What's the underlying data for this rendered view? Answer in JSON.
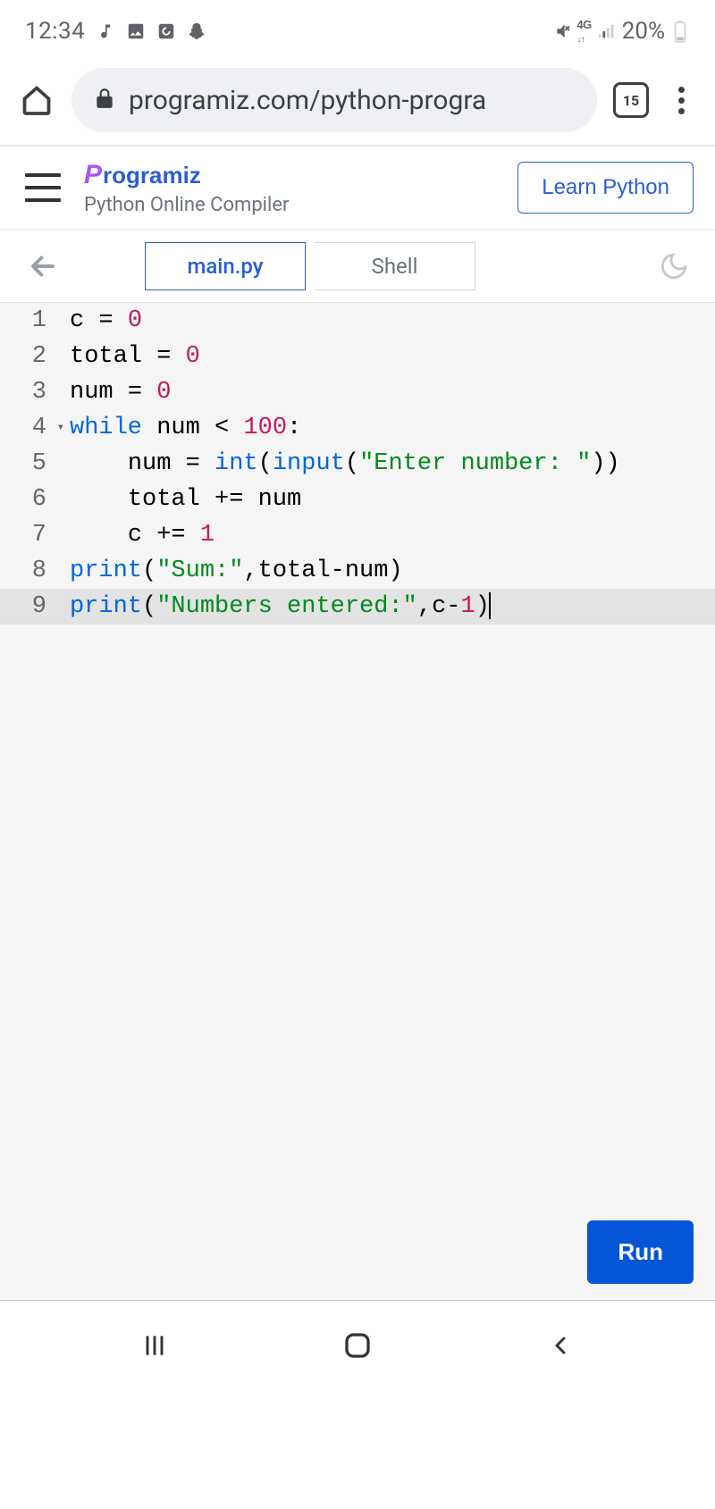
{
  "status": {
    "time": "12:34",
    "battery_pct": "20%",
    "icons": [
      "music-note",
      "image",
      "refresh-box",
      "snapchat"
    ],
    "net_label": "4G"
  },
  "browser": {
    "url": "programiz.com/python-progra",
    "tab_count": "15"
  },
  "site": {
    "brand": "rogramiz",
    "brand_prefix": "P",
    "subtitle": "Python Online Compiler",
    "learn_btn": "Learn Python"
  },
  "tabs": {
    "main": "main.py",
    "shell": "Shell"
  },
  "editor": {
    "lines": [
      {
        "n": 1,
        "indent": "",
        "tokens": [
          [
            "txt",
            "c "
          ],
          [
            "op",
            "="
          ],
          [
            "txt",
            " "
          ],
          [
            "num",
            "0"
          ]
        ]
      },
      {
        "n": 2,
        "indent": "",
        "tokens": [
          [
            "txt",
            "total "
          ],
          [
            "op",
            "="
          ],
          [
            "txt",
            " "
          ],
          [
            "num",
            "0"
          ]
        ]
      },
      {
        "n": 3,
        "indent": "",
        "tokens": [
          [
            "txt",
            "num "
          ],
          [
            "op",
            "="
          ],
          [
            "txt",
            " "
          ],
          [
            "num",
            "0"
          ]
        ]
      },
      {
        "n": 4,
        "indent": "",
        "fold": true,
        "tokens": [
          [
            "kw",
            "while"
          ],
          [
            "txt",
            " num "
          ],
          [
            "op",
            "<"
          ],
          [
            "txt",
            " "
          ],
          [
            "num",
            "100"
          ],
          [
            "txt",
            ":"
          ]
        ]
      },
      {
        "n": 5,
        "indent": "    ",
        "tokens": [
          [
            "txt",
            "num "
          ],
          [
            "op",
            "="
          ],
          [
            "txt",
            " "
          ],
          [
            "builtin",
            "int"
          ],
          [
            "txt",
            "("
          ],
          [
            "builtin",
            "input"
          ],
          [
            "txt",
            "("
          ],
          [
            "str",
            "\"Enter number: \""
          ],
          [
            "txt",
            "))"
          ]
        ]
      },
      {
        "n": 6,
        "indent": "    ",
        "tokens": [
          [
            "txt",
            "total "
          ],
          [
            "op",
            "+="
          ],
          [
            "txt",
            " num"
          ]
        ]
      },
      {
        "n": 7,
        "indent": "    ",
        "tokens": [
          [
            "txt",
            "c "
          ],
          [
            "op",
            "+="
          ],
          [
            "txt",
            " "
          ],
          [
            "num",
            "1"
          ]
        ]
      },
      {
        "n": 8,
        "indent": "",
        "tokens": [
          [
            "builtin",
            "print"
          ],
          [
            "txt",
            "("
          ],
          [
            "str",
            "\"Sum:\""
          ],
          [
            "txt",
            ",total"
          ],
          [
            "op",
            "-"
          ],
          [
            "txt",
            "num)"
          ]
        ]
      },
      {
        "n": 9,
        "indent": "",
        "active": true,
        "tokens": [
          [
            "builtin",
            "print"
          ],
          [
            "txt",
            "("
          ],
          [
            "str",
            "\"Numbers entered:\""
          ],
          [
            "txt",
            ",c"
          ],
          [
            "op",
            "-"
          ],
          [
            "num",
            "1"
          ],
          [
            "txt",
            ")"
          ]
        ]
      }
    ]
  },
  "run_label": "Run"
}
